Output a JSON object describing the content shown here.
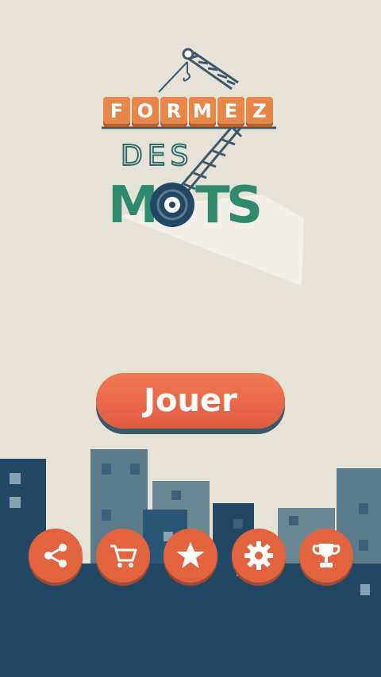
{
  "logo": {
    "line1_letters": [
      "F",
      "O",
      "R",
      "M",
      "E",
      "Z"
    ],
    "line2": "DES",
    "line3_letters": [
      "M",
      "O",
      "T",
      "S"
    ]
  },
  "play_button": {
    "label": "Jouer"
  },
  "bottom_bar": {
    "buttons": [
      {
        "icon": "share-icon"
      },
      {
        "icon": "cart-icon"
      },
      {
        "icon": "star-icon"
      },
      {
        "icon": "gear-icon"
      },
      {
        "icon": "trophy-icon"
      }
    ]
  },
  "colors": {
    "background": "#e6e2d6",
    "accent_orange": "#e2643f",
    "tile_orange": "#e8874a",
    "teal": "#2f8a6e",
    "city_dark": "#224866",
    "city_mid": "#5d7c8b"
  }
}
